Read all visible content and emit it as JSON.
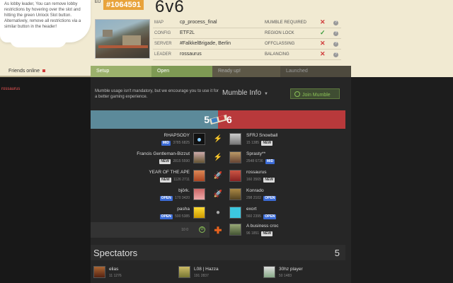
{
  "header": {
    "help_text": "As lobby leader, You can remove lobby restrictions by hovering over the slot and hitting the green Unlock Slot button. Alternatively, remove all restrictions via a similar button in the header!",
    "lobby_prefix": "EU",
    "lobby_id": "#1064591",
    "lobby_name": "6v6",
    "info": [
      {
        "key": "MAP",
        "value": "cp_process_final",
        "setting": "MUMBLE REQUIRED",
        "state": "✕"
      },
      {
        "key": "CONFIG",
        "value": "ETF2L",
        "setting": "REGION LOCK",
        "state": "✓"
      },
      {
        "key": "SERVER",
        "value": "#FalkkelBrigade, Berlin",
        "setting": "OFFCLASSING",
        "state": "✕"
      },
      {
        "key": "LEADER",
        "value": "rossaurus",
        "setting": "BALANCING",
        "state": "✕"
      }
    ],
    "help_icon": "?"
  },
  "statusbar": {
    "friends_label": "Friends online",
    "steps": [
      "Setup",
      "Open",
      "Ready up!",
      "Launched"
    ]
  },
  "left_panel": {
    "user": "rossaurus"
  },
  "mumble": {
    "note": "Mumble usage isn't mandatory, but we encourage you to use it for a better gaming experience.",
    "title": "Mumble Info",
    "arrow": "▼",
    "join_label": "Join Mumble"
  },
  "teams": {
    "blu_count": "5",
    "red_count": "6"
  },
  "blu": [
    {
      "name": "RHAPSODY",
      "s1": "3785",
      "s2": "6825",
      "badge": "MID",
      "badge_class": "b-mid"
    },
    {
      "name": "Francis Gentleman-Bizzut",
      "s1": "2815",
      "s2": "5590",
      "badge": "NEW",
      "badge_class": "b-new"
    },
    {
      "name": "YEAR OF THE APE",
      "s1": "1126",
      "s2": "2711",
      "badge": "NEW",
      "badge_class": "b-new"
    },
    {
      "name": "björk.",
      "s1": "170",
      "s2": "3420",
      "badge": "OPEN",
      "badge_class": "b-open"
    },
    {
      "name": "pasha",
      "s1": "590",
      "s2": "5385",
      "badge": "OPEN",
      "badge_class": "b-open"
    }
  ],
  "red": [
    {
      "name": "SFRJ Snowball",
      "s1": "15",
      "s2": "1385",
      "badge": "NEW",
      "badge_class": "b-new"
    },
    {
      "name": "Sprasty**",
      "s1": "2548",
      "s2": "6736",
      "badge": "MID",
      "badge_class": "b-mid"
    },
    {
      "name": "rossaurus",
      "s1": "160",
      "s2": "3565",
      "badge": "NEW",
      "badge_class": "b-new"
    },
    {
      "name": "Konrado",
      "s1": "298",
      "s2": "2102",
      "badge": "OPEN",
      "badge_class": "b-open"
    },
    {
      "name": "exort",
      "s1": "560",
      "s2": "2395",
      "badge": "OPEN",
      "badge_class": "b-open"
    },
    {
      "name": "A business croc",
      "s1": "96",
      "s2": "1851",
      "badge": "NEW",
      "badge_class": "b-new"
    }
  ],
  "empty_slot": {
    "s1": "10",
    "s2": "0"
  },
  "spectators": {
    "title": "Spectators",
    "count": "5",
    "list": [
      {
        "name": "elias",
        "s1": "11",
        "s2": "1276"
      },
      {
        "name": "L08 | Hazza",
        "s1": "191",
        "s2": "2837"
      },
      {
        "name": "30hz player",
        "s1": "50",
        "s2": "1483"
      }
    ]
  },
  "colors": {
    "blu": "#5c8a9a",
    "red": "#b8393b",
    "accent": "#e8a33b",
    "green": "#8ac057"
  }
}
